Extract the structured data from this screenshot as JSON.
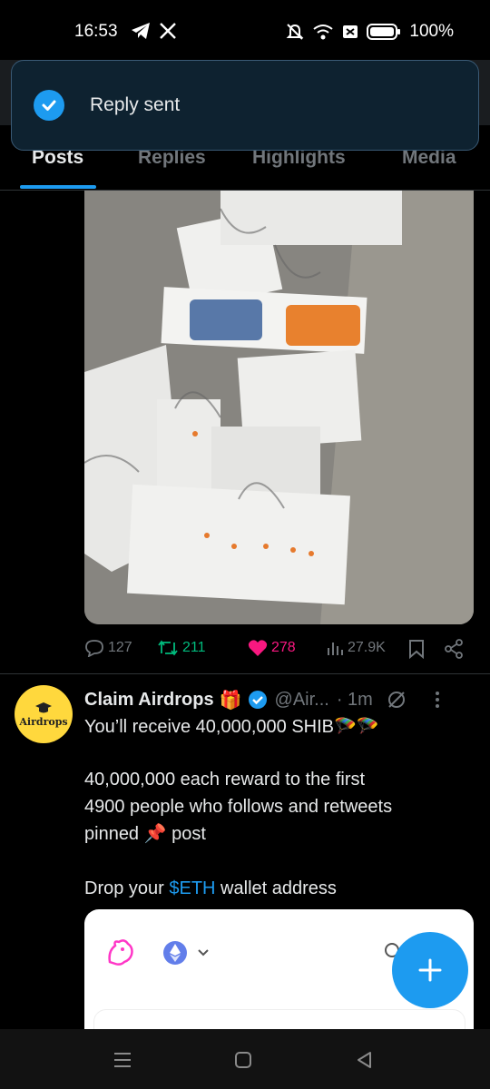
{
  "status_bar": {
    "time": "16:53",
    "battery": "100%",
    "icons": [
      "telegram-icon",
      "x-icon",
      "mute-icon",
      "wifi-icon",
      "data-icon",
      "battery-icon"
    ]
  },
  "toast": {
    "text": "Reply sent",
    "icon": "check-circle-icon"
  },
  "tabs": [
    {
      "label": "Posts",
      "active": true
    },
    {
      "label": "Replies",
      "active": false
    },
    {
      "label": "Highlights",
      "active": false
    },
    {
      "label": "Media",
      "active": false
    }
  ],
  "post1": {
    "actions": {
      "replies": "127",
      "reposts": "211",
      "likes": "278",
      "views": "27.9K"
    }
  },
  "post2": {
    "avatar_text": "Airdrops",
    "name": "Claim Airdrops",
    "name_emoji": "🎁",
    "handle": "@Air...",
    "time": "· 1m",
    "line1": "You’ll receive 40,000,000 SHIB🪂🪂",
    "para2_line1": "40,000,000 each reward to the first",
    "para2_line2": "4900 people who follows and retweets",
    "para2_line3": "pinned 📌 post",
    "drop_prefix": "Drop your ",
    "cashtag": "$ETH",
    "drop_suffix": " wallet address"
  },
  "colors": {
    "accent": "#1d9bf0",
    "like": "#f91880",
    "repost": "#00ba7c",
    "muted": "#71767b",
    "verified": "#1d9bf0"
  }
}
